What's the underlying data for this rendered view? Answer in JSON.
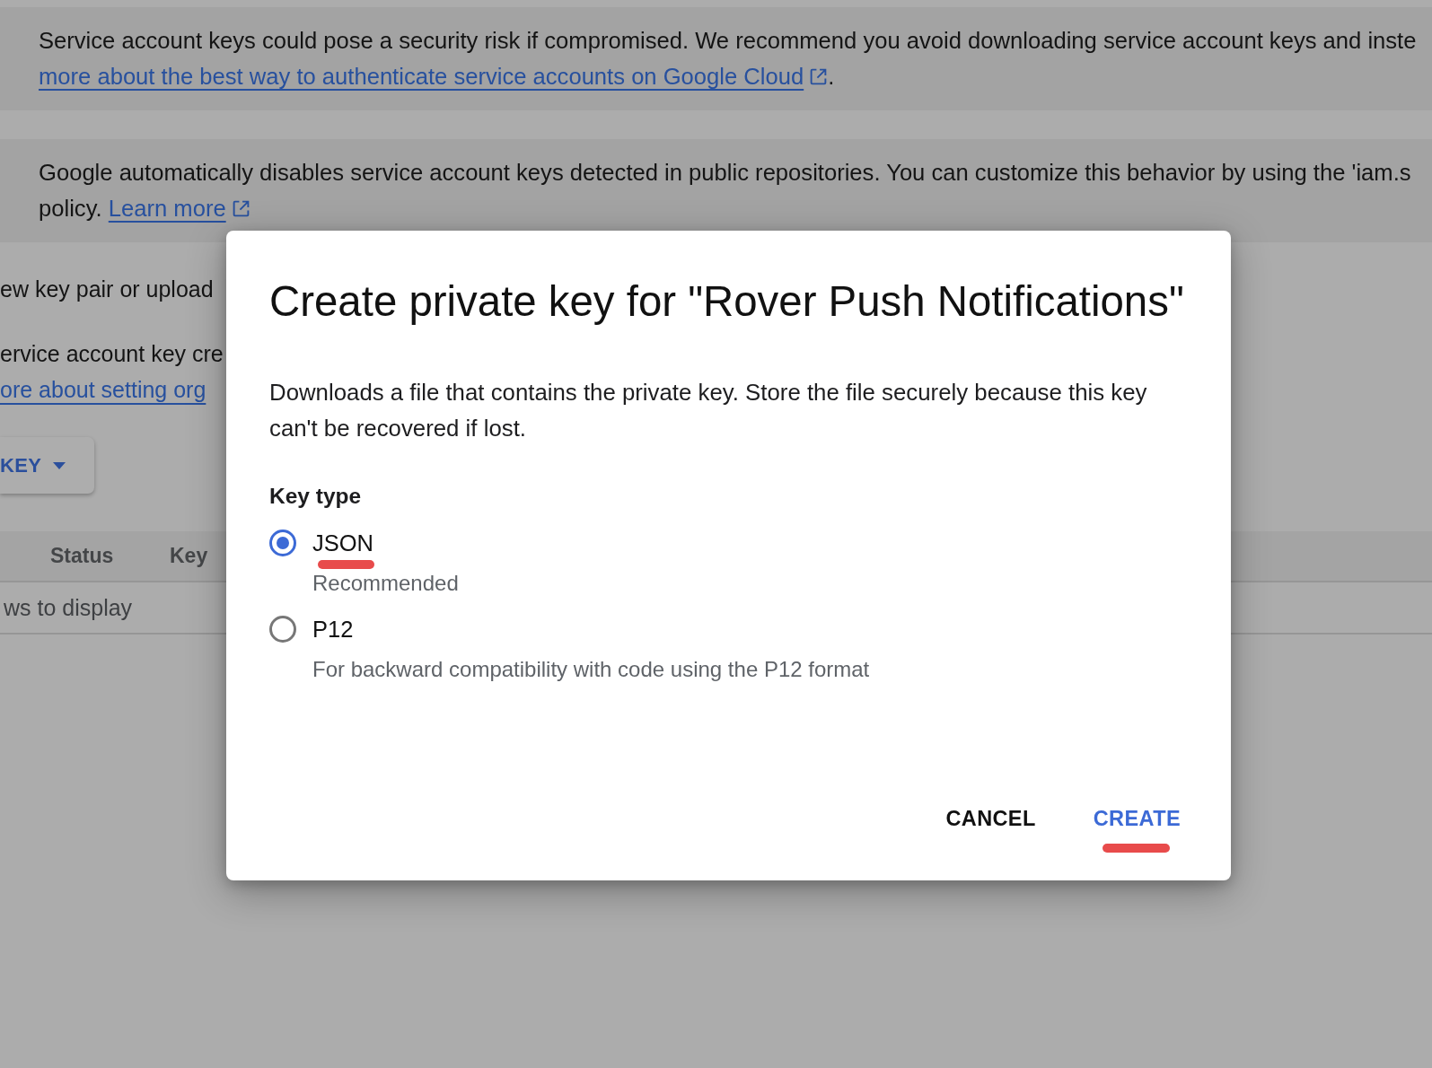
{
  "banners": [
    {
      "lines": [
        [
          {
            "kind": "text",
            "text": "Service account keys could pose a security risk if compromised. We recommend you avoid downloading service account keys and inste"
          }
        ],
        [
          {
            "kind": "link",
            "text": "more about the best way to authenticate service accounts on Google Cloud",
            "external": true
          },
          {
            "kind": "text",
            "text": "."
          }
        ]
      ]
    },
    {
      "lines": [
        [
          {
            "kind": "text",
            "text": "Google automatically disables service account keys detected in public repositories. You can customize this behavior by using the 'iam.s"
          }
        ],
        [
          {
            "kind": "text",
            "text": "policy."
          },
          {
            "kind": "link",
            "text": "Learn more",
            "external": true
          }
        ]
      ]
    }
  ],
  "keys_section": {
    "intro_text": "ew key pair or upload",
    "policy_text": "ervice account key cre",
    "policy_link": "ore about setting org",
    "add_key_button": {
      "label": "KEY"
    },
    "table": {
      "columns": [
        "Status",
        "Key"
      ],
      "empty_message": "ws to display"
    }
  },
  "dialog": {
    "title": "Create private key for \"Rover Push Notifications\"",
    "description": "Downloads a file that contains the private key. Store the file securely because this key can't be recovered if lost.",
    "key_type": {
      "label": "Key type",
      "options": [
        {
          "label": "JSON",
          "hint": "Recommended",
          "selected": true,
          "annotated": true
        },
        {
          "label": "P12",
          "hint": "For backward compatibility with code using the P12 format",
          "selected": false,
          "annotated": false
        }
      ]
    },
    "buttons": [
      {
        "label": "CANCEL",
        "kind": "secondary",
        "annotated": false
      },
      {
        "label": "CREATE",
        "kind": "primary",
        "annotated": true
      }
    ]
  }
}
